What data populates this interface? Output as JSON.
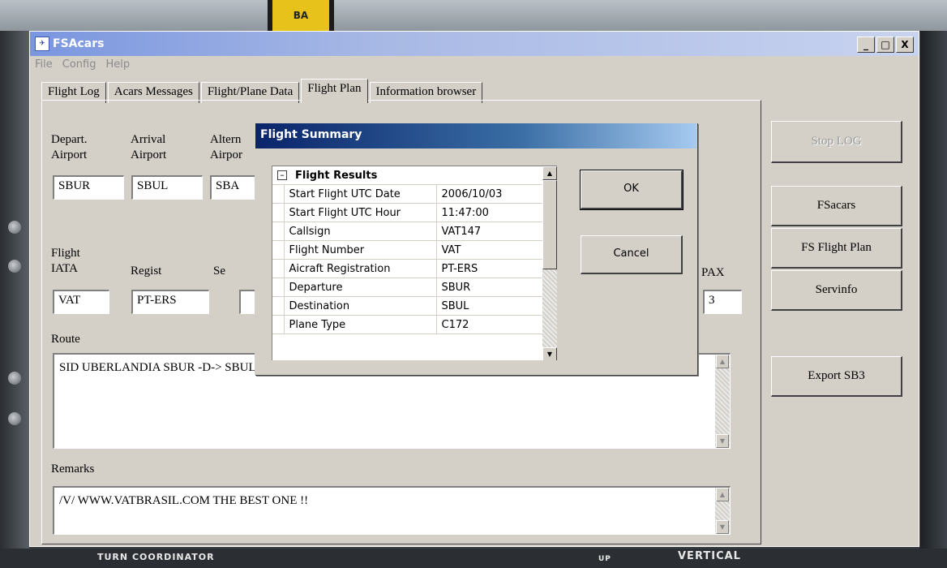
{
  "window": {
    "title": "FSAcars",
    "minimize": "_",
    "maximize": "□",
    "close": "X"
  },
  "menu": [
    "File",
    "Config",
    "Help"
  ],
  "tabs": [
    "Flight Log",
    "Acars Messages",
    "Flight/Plane Data",
    "Flight Plan",
    "Information browser"
  ],
  "active_tab": "Flight Plan",
  "form": {
    "depart_label": [
      "Depart.",
      "Airport"
    ],
    "arrival_label": [
      "Arrival",
      "Airport"
    ],
    "alternate_label": [
      "Altern",
      "Airpor"
    ],
    "depart": "SBUR",
    "arrival": "SBUL",
    "alternate": "SBA",
    "flight_label": [
      "Flight",
      "IATA"
    ],
    "regist_label": "Regist",
    "se_label": "Se",
    "pax_label": "PAX",
    "flight": "VAT",
    "regist": "PT-ERS",
    "pax": "3",
    "route_label": "Route",
    "route": "SID UBERLANDIA SBUR -D-> SBUL",
    "remarks_label": "Remarks",
    "remarks": "/V/ WWW.VATBRASIL.COM THE BEST ONE !!"
  },
  "side_buttons": [
    "Stop LOG",
    "FSacars",
    "FS Flight Plan",
    "Servinfo",
    "Export SB3"
  ],
  "dialog": {
    "title": "Flight Summary",
    "group": "Flight Results",
    "rows": [
      {
        "k": "Start Flight UTC Date",
        "v": "2006/10/03"
      },
      {
        "k": "Start Flight UTC Hour",
        "v": "11:47:00"
      },
      {
        "k": "Callsign",
        "v": "VAT147"
      },
      {
        "k": "Flight Number",
        "v": "VAT"
      },
      {
        "k": "Aicraft Registration",
        "v": "PT-ERS"
      },
      {
        "k": "Departure",
        "v": "SBUR"
      },
      {
        "k": "Destination",
        "v": "SBUL"
      },
      {
        "k": "Plane Type",
        "v": "C172"
      }
    ],
    "ok": "OK",
    "cancel": "Cancel"
  },
  "background": {
    "tape": "BA",
    "turn_coordinator": "TURN COORDINATOR",
    "vertical": "VERTICAL",
    "up": "UP"
  }
}
